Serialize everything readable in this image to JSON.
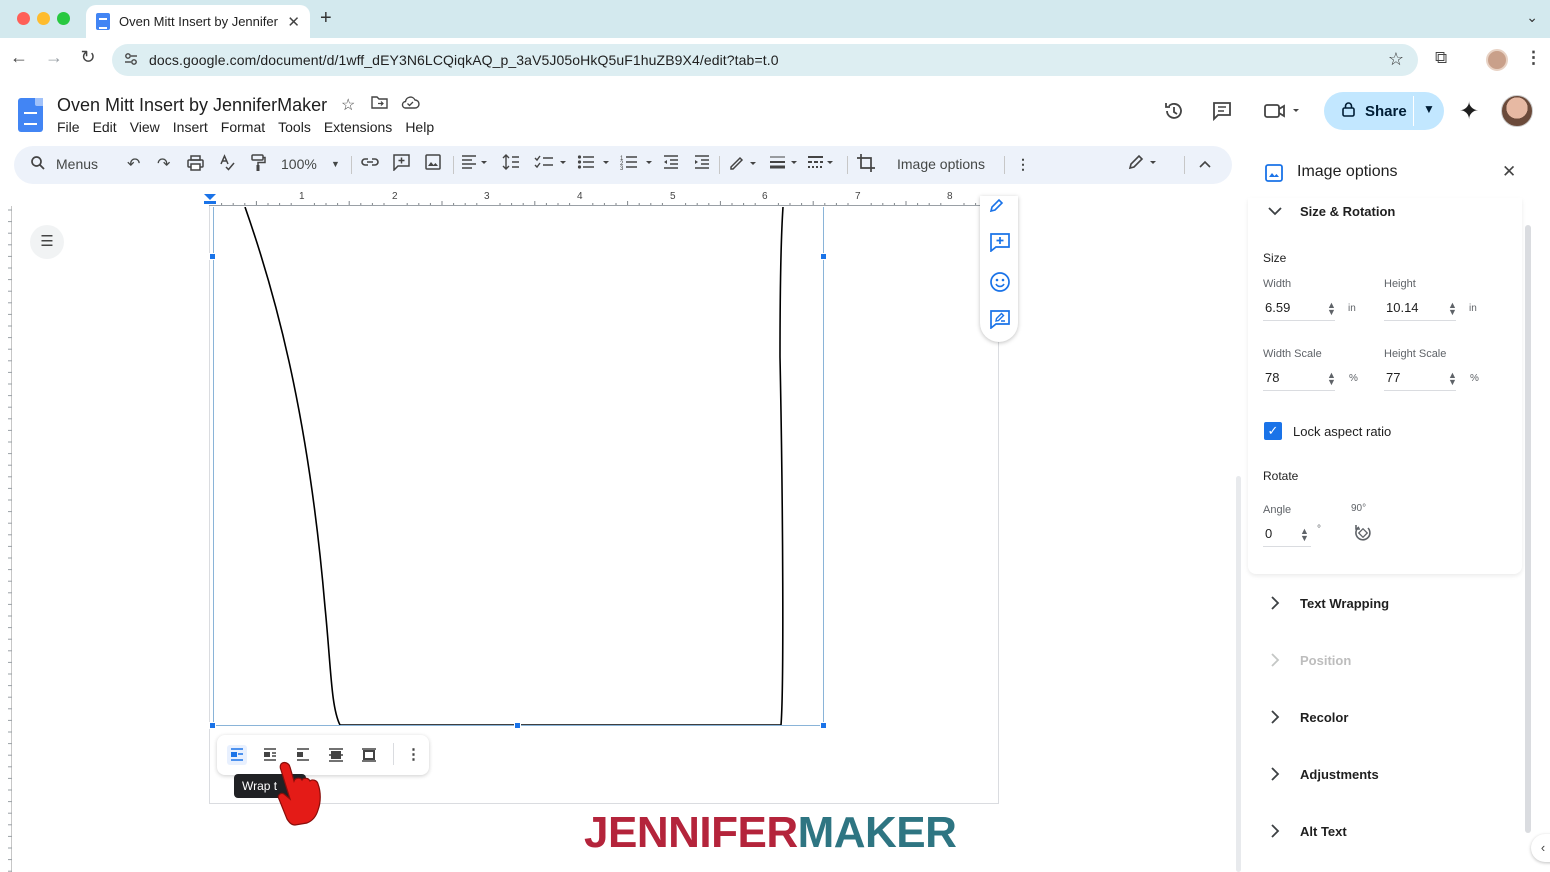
{
  "browser": {
    "tab_title": "Oven Mitt Insert by JenniferMaker",
    "tab_close": "✕",
    "new_tab": "+",
    "url": "docs.google.com/document/d/1wff_dEY3N6LCQiqkAQ_p_3aV5J05oHkQ5uF1huZB9X4/edit?tab=t.0",
    "colors": {
      "tabbar": "#d3e9ee",
      "close": "#ff5f57",
      "minimize": "#febc2e",
      "maximize": "#28c840"
    }
  },
  "doc": {
    "title": "Oven Mitt Insert by JenniferMaker",
    "menu": [
      "File",
      "Edit",
      "View",
      "Insert",
      "Format",
      "Tools",
      "Extensions",
      "Help"
    ],
    "share_label": "Share"
  },
  "toolbar": {
    "search_label": "Menus",
    "zoom": "100%",
    "image_options_label": "Image options"
  },
  "ruler": {
    "marks": [
      "1",
      "2",
      "3",
      "4",
      "5",
      "6",
      "7",
      "8"
    ]
  },
  "panel": {
    "title": "Image options",
    "size_rotation": "Size & Rotation",
    "size_heading": "Size",
    "width_label": "Width",
    "width_value": "6.59",
    "height_label": "Height",
    "height_value": "10.14",
    "unit_in": "in",
    "width_scale_label": "Width Scale",
    "width_scale_value": "78",
    "height_scale_label": "Height Scale",
    "height_scale_value": "77",
    "unit_pct": "%",
    "lock_aspect": "Lock aspect ratio",
    "lock_checked": true,
    "rotate_heading": "Rotate",
    "angle_label": "Angle",
    "angle_value": "0",
    "angle_unit": "°",
    "rotate_90": "90°",
    "sections": [
      "Text Wrapping",
      "Position",
      "Recolor",
      "Adjustments",
      "Alt Text"
    ]
  },
  "canvas": {
    "tooltip": "Wrap t"
  },
  "watermark": {
    "part1": "JENNIFER",
    "part2": "MAKER",
    "color1": "#b4243b",
    "color2": "#2e7582"
  },
  "icons": [
    "back-icon",
    "forward-icon",
    "reload-icon",
    "star-icon",
    "extensions-icon",
    "history-icon",
    "comment-icon",
    "meet-icon",
    "lock-icon",
    "gemini-icon",
    "undo-icon",
    "redo-icon",
    "print-icon",
    "spellcheck-icon",
    "paint-format-icon",
    "link-icon",
    "add-comment-icon",
    "insert-image-icon",
    "crop-icon",
    "pencil-icon"
  ]
}
